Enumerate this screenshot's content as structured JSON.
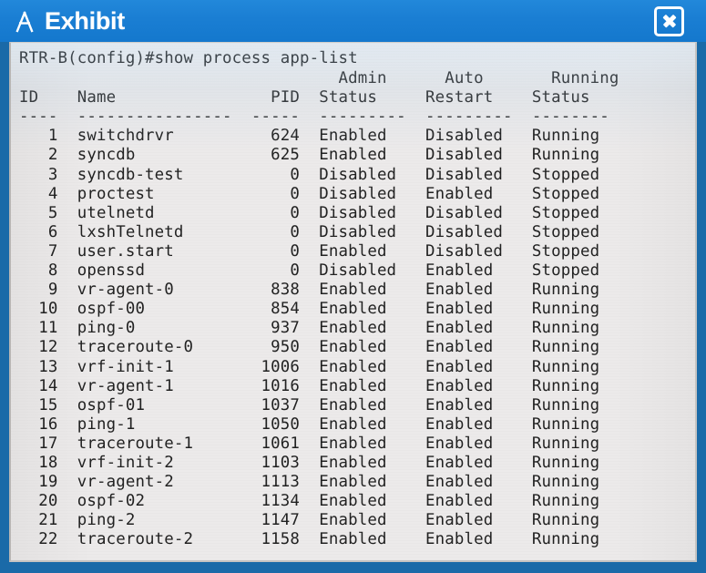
{
  "window": {
    "title": "Exhibit",
    "app_icon": "easel-icon",
    "close_icon": "close-icon",
    "titlebar_color": "#1a7fd4",
    "terminal_background": "#eceaea",
    "terminal_text_color": "#262626"
  },
  "terminal": {
    "prompt": "RTR-B(config)#",
    "command": "show process app-list",
    "command_line": "RTR-B(config)#show process app-list",
    "header_line_1": "                                Admin      Auto       Running",
    "header_line_2": "ID    Name               PID   Status     Restart    Status",
    "separator_line": "----  ----------------  -----  ---------  ---------  --------",
    "columns": [
      "ID",
      "Name",
      "PID",
      "Admin Status",
      "Auto Restart",
      "Running Status"
    ],
    "rows": [
      {
        "id": "1",
        "name": "switchdrvr",
        "pid": "624",
        "admin_status": "Enabled",
        "auto_restart": "Disabled",
        "running_status": "Running"
      },
      {
        "id": "2",
        "name": "syncdb",
        "pid": "625",
        "admin_status": "Enabled",
        "auto_restart": "Disabled",
        "running_status": "Running"
      },
      {
        "id": "3",
        "name": "syncdb-test",
        "pid": "0",
        "admin_status": "Disabled",
        "auto_restart": "Disabled",
        "running_status": "Stopped"
      },
      {
        "id": "4",
        "name": "proctest",
        "pid": "0",
        "admin_status": "Disabled",
        "auto_restart": "Enabled",
        "running_status": "Stopped"
      },
      {
        "id": "5",
        "name": "utelnetd",
        "pid": "0",
        "admin_status": "Disabled",
        "auto_restart": "Disabled",
        "running_status": "Stopped"
      },
      {
        "id": "6",
        "name": "lxshTelnetd",
        "pid": "0",
        "admin_status": "Disabled",
        "auto_restart": "Disabled",
        "running_status": "Stopped"
      },
      {
        "id": "7",
        "name": "user.start",
        "pid": "0",
        "admin_status": "Enabled",
        "auto_restart": "Disabled",
        "running_status": "Stopped"
      },
      {
        "id": "8",
        "name": "openssd",
        "pid": "0",
        "admin_status": "Disabled",
        "auto_restart": "Enabled",
        "running_status": "Stopped"
      },
      {
        "id": "9",
        "name": "vr-agent-0",
        "pid": "838",
        "admin_status": "Enabled",
        "auto_restart": "Enabled",
        "running_status": "Running"
      },
      {
        "id": "10",
        "name": "ospf-00",
        "pid": "854",
        "admin_status": "Enabled",
        "auto_restart": "Enabled",
        "running_status": "Running"
      },
      {
        "id": "11",
        "name": "ping-0",
        "pid": "937",
        "admin_status": "Enabled",
        "auto_restart": "Enabled",
        "running_status": "Running"
      },
      {
        "id": "12",
        "name": "traceroute-0",
        "pid": "950",
        "admin_status": "Enabled",
        "auto_restart": "Enabled",
        "running_status": "Running"
      },
      {
        "id": "13",
        "name": "vrf-init-1",
        "pid": "1006",
        "admin_status": "Enabled",
        "auto_restart": "Enabled",
        "running_status": "Running"
      },
      {
        "id": "14",
        "name": "vr-agent-1",
        "pid": "1016",
        "admin_status": "Enabled",
        "auto_restart": "Enabled",
        "running_status": "Running"
      },
      {
        "id": "15",
        "name": "ospf-01",
        "pid": "1037",
        "admin_status": "Enabled",
        "auto_restart": "Enabled",
        "running_status": "Running"
      },
      {
        "id": "16",
        "name": "ping-1",
        "pid": "1050",
        "admin_status": "Enabled",
        "auto_restart": "Enabled",
        "running_status": "Running"
      },
      {
        "id": "17",
        "name": "traceroute-1",
        "pid": "1061",
        "admin_status": "Enabled",
        "auto_restart": "Enabled",
        "running_status": "Running"
      },
      {
        "id": "18",
        "name": "vrf-init-2",
        "pid": "1103",
        "admin_status": "Enabled",
        "auto_restart": "Enabled",
        "running_status": "Running"
      },
      {
        "id": "19",
        "name": "vr-agent-2",
        "pid": "1113",
        "admin_status": "Enabled",
        "auto_restart": "Enabled",
        "running_status": "Running"
      },
      {
        "id": "20",
        "name": "ospf-02",
        "pid": "1134",
        "admin_status": "Enabled",
        "auto_restart": "Enabled",
        "running_status": "Running"
      },
      {
        "id": "21",
        "name": "ping-2",
        "pid": "1147",
        "admin_status": "Enabled",
        "auto_restart": "Enabled",
        "running_status": "Running"
      },
      {
        "id": "22",
        "name": "traceroute-2",
        "pid": "1158",
        "admin_status": "Enabled",
        "auto_restart": "Enabled",
        "running_status": "Running"
      }
    ]
  }
}
